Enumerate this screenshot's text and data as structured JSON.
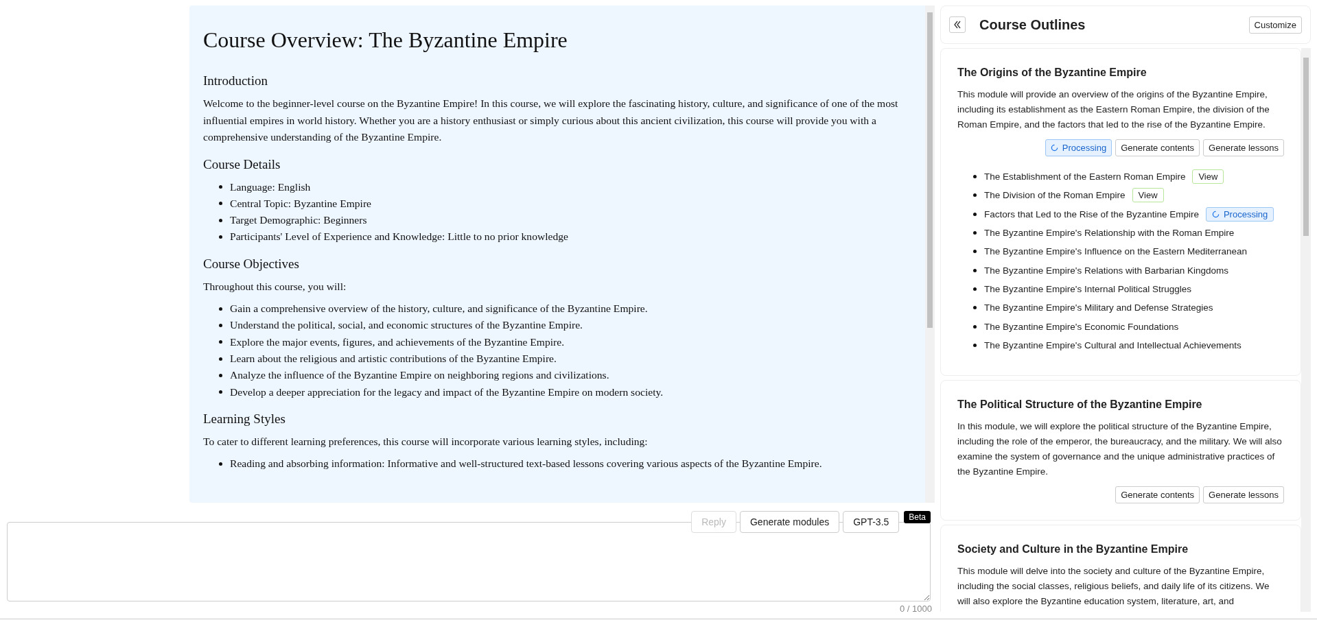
{
  "document": {
    "title": "Course Overview: The Byzantine Empire",
    "sections": [
      {
        "heading": "Introduction",
        "paragraph": "Welcome to the beginner-level course on the Byzantine Empire! In this course, we will explore the fascinating history, culture, and significance of one of the most influential empires in world history. Whether you are a history enthusiast or simply curious about this ancient civilization, this course will provide you with a comprehensive understanding of the Byzantine Empire."
      },
      {
        "heading": "Course Details",
        "items": [
          "Language: English",
          "Central Topic: Byzantine Empire",
          "Target Demographic: Beginners",
          "Participants' Level of Experience and Knowledge: Little to no prior knowledge"
        ]
      },
      {
        "heading": "Course Objectives",
        "paragraph": "Throughout this course, you will:",
        "items": [
          "Gain a comprehensive overview of the history, culture, and significance of the Byzantine Empire.",
          "Understand the political, social, and economic structures of the Byzantine Empire.",
          "Explore the major events, figures, and achievements of the Byzantine Empire.",
          "Learn about the religious and artistic contributions of the Byzantine Empire.",
          "Analyze the influence of the Byzantine Empire on neighboring regions and civilizations.",
          "Develop a deeper appreciation for the legacy and impact of the Byzantine Empire on modern society."
        ]
      },
      {
        "heading": "Learning Styles",
        "paragraph": "To cater to different learning preferences, this course will incorporate various learning styles, including:",
        "items": [
          "Reading and absorbing information: Informative and well-structured text-based lessons covering various aspects of the Byzantine Empire."
        ]
      }
    ]
  },
  "composer": {
    "buttons": [
      {
        "label": "Reply",
        "disabled": true
      },
      {
        "label": "Generate modules",
        "disabled": false
      },
      {
        "label": "GPT-3.5",
        "disabled": false
      }
    ],
    "badge": "Beta",
    "counter": "0 / 1000"
  },
  "outline": {
    "title": "Course Outlines",
    "customize": "Customize",
    "modules": [
      {
        "title": "The Origins of the Byzantine Empire",
        "description": "This module will provide an overview of the origins of the Byzantine Empire, including its establishment as the Eastern Roman Empire, the division of the Roman Empire, and the factors that led to the rise of the Byzantine Empire.",
        "status": {
          "kind": "processing",
          "label": "Processing"
        },
        "buttons": [
          "Generate contents",
          "Generate lessons"
        ],
        "lessons": [
          {
            "title": "The Establishment of the Eastern Roman Empire",
            "status": {
              "kind": "view",
              "label": "View"
            }
          },
          {
            "title": "The Division of the Roman Empire",
            "status": {
              "kind": "view",
              "label": "View"
            }
          },
          {
            "title": "Factors that Led to the Rise of the Byzantine Empire",
            "status": {
              "kind": "processing",
              "label": "Processing"
            }
          },
          {
            "title": "The Byzantine Empire's Relationship with the Roman Empire"
          },
          {
            "title": "The Byzantine Empire's Influence on the Eastern Mediterranean"
          },
          {
            "title": "The Byzantine Empire's Relations with Barbarian Kingdoms"
          },
          {
            "title": "The Byzantine Empire's Internal Political Struggles"
          },
          {
            "title": "The Byzantine Empire's Military and Defense Strategies"
          },
          {
            "title": "The Byzantine Empire's Economic Foundations"
          },
          {
            "title": "The Byzantine Empire's Cultural and Intellectual Achievements"
          }
        ]
      },
      {
        "title": "The Political Structure of the Byzantine Empire",
        "description": "In this module, we will explore the political structure of the Byzantine Empire, including the role of the emperor, the bureaucracy, and the military. We will also examine the system of governance and the unique administrative practices of the Byzantine Empire.",
        "buttons": [
          "Generate contents",
          "Generate lessons"
        ]
      },
      {
        "title": "Society and Culture in the Byzantine Empire",
        "description": "This module will delve into the society and culture of the Byzantine Empire, including the social classes, religious beliefs, and daily life of its citizens. We will also explore the Byzantine education system, literature, art, and"
      }
    ]
  }
}
